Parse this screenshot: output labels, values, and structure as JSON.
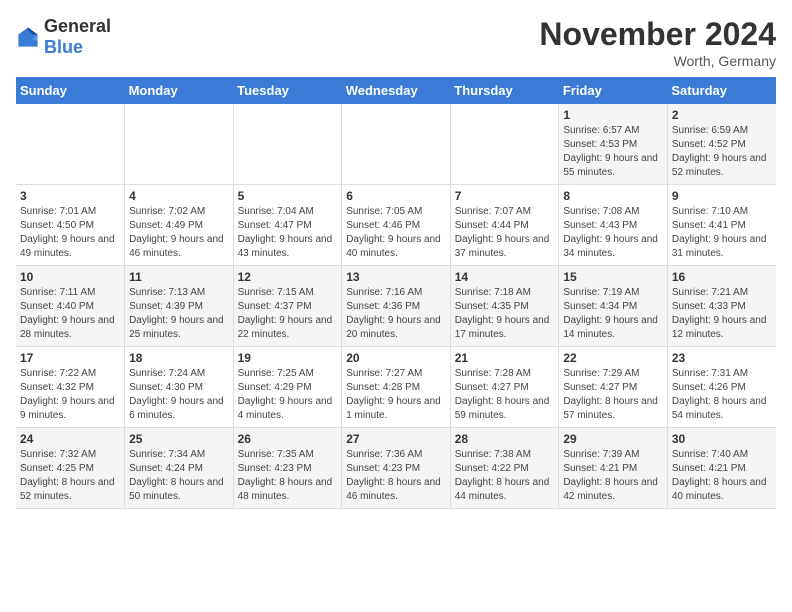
{
  "header": {
    "logo_general": "General",
    "logo_blue": "Blue",
    "title": "November 2024",
    "location": "Worth, Germany"
  },
  "days_of_week": [
    "Sunday",
    "Monday",
    "Tuesday",
    "Wednesday",
    "Thursday",
    "Friday",
    "Saturday"
  ],
  "weeks": [
    [
      {
        "day": "",
        "info": ""
      },
      {
        "day": "",
        "info": ""
      },
      {
        "day": "",
        "info": ""
      },
      {
        "day": "",
        "info": ""
      },
      {
        "day": "",
        "info": ""
      },
      {
        "day": "1",
        "info": "Sunrise: 6:57 AM\nSunset: 4:53 PM\nDaylight: 9 hours and 55 minutes."
      },
      {
        "day": "2",
        "info": "Sunrise: 6:59 AM\nSunset: 4:52 PM\nDaylight: 9 hours and 52 minutes."
      }
    ],
    [
      {
        "day": "3",
        "info": "Sunrise: 7:01 AM\nSunset: 4:50 PM\nDaylight: 9 hours and 49 minutes."
      },
      {
        "day": "4",
        "info": "Sunrise: 7:02 AM\nSunset: 4:49 PM\nDaylight: 9 hours and 46 minutes."
      },
      {
        "day": "5",
        "info": "Sunrise: 7:04 AM\nSunset: 4:47 PM\nDaylight: 9 hours and 43 minutes."
      },
      {
        "day": "6",
        "info": "Sunrise: 7:05 AM\nSunset: 4:46 PM\nDaylight: 9 hours and 40 minutes."
      },
      {
        "day": "7",
        "info": "Sunrise: 7:07 AM\nSunset: 4:44 PM\nDaylight: 9 hours and 37 minutes."
      },
      {
        "day": "8",
        "info": "Sunrise: 7:08 AM\nSunset: 4:43 PM\nDaylight: 9 hours and 34 minutes."
      },
      {
        "day": "9",
        "info": "Sunrise: 7:10 AM\nSunset: 4:41 PM\nDaylight: 9 hours and 31 minutes."
      }
    ],
    [
      {
        "day": "10",
        "info": "Sunrise: 7:11 AM\nSunset: 4:40 PM\nDaylight: 9 hours and 28 minutes."
      },
      {
        "day": "11",
        "info": "Sunrise: 7:13 AM\nSunset: 4:39 PM\nDaylight: 9 hours and 25 minutes."
      },
      {
        "day": "12",
        "info": "Sunrise: 7:15 AM\nSunset: 4:37 PM\nDaylight: 9 hours and 22 minutes."
      },
      {
        "day": "13",
        "info": "Sunrise: 7:16 AM\nSunset: 4:36 PM\nDaylight: 9 hours and 20 minutes."
      },
      {
        "day": "14",
        "info": "Sunrise: 7:18 AM\nSunset: 4:35 PM\nDaylight: 9 hours and 17 minutes."
      },
      {
        "day": "15",
        "info": "Sunrise: 7:19 AM\nSunset: 4:34 PM\nDaylight: 9 hours and 14 minutes."
      },
      {
        "day": "16",
        "info": "Sunrise: 7:21 AM\nSunset: 4:33 PM\nDaylight: 9 hours and 12 minutes."
      }
    ],
    [
      {
        "day": "17",
        "info": "Sunrise: 7:22 AM\nSunset: 4:32 PM\nDaylight: 9 hours and 9 minutes."
      },
      {
        "day": "18",
        "info": "Sunrise: 7:24 AM\nSunset: 4:30 PM\nDaylight: 9 hours and 6 minutes."
      },
      {
        "day": "19",
        "info": "Sunrise: 7:25 AM\nSunset: 4:29 PM\nDaylight: 9 hours and 4 minutes."
      },
      {
        "day": "20",
        "info": "Sunrise: 7:27 AM\nSunset: 4:28 PM\nDaylight: 9 hours and 1 minute."
      },
      {
        "day": "21",
        "info": "Sunrise: 7:28 AM\nSunset: 4:27 PM\nDaylight: 8 hours and 59 minutes."
      },
      {
        "day": "22",
        "info": "Sunrise: 7:29 AM\nSunset: 4:27 PM\nDaylight: 8 hours and 57 minutes."
      },
      {
        "day": "23",
        "info": "Sunrise: 7:31 AM\nSunset: 4:26 PM\nDaylight: 8 hours and 54 minutes."
      }
    ],
    [
      {
        "day": "24",
        "info": "Sunrise: 7:32 AM\nSunset: 4:25 PM\nDaylight: 8 hours and 52 minutes."
      },
      {
        "day": "25",
        "info": "Sunrise: 7:34 AM\nSunset: 4:24 PM\nDaylight: 8 hours and 50 minutes."
      },
      {
        "day": "26",
        "info": "Sunrise: 7:35 AM\nSunset: 4:23 PM\nDaylight: 8 hours and 48 minutes."
      },
      {
        "day": "27",
        "info": "Sunrise: 7:36 AM\nSunset: 4:23 PM\nDaylight: 8 hours and 46 minutes."
      },
      {
        "day": "28",
        "info": "Sunrise: 7:38 AM\nSunset: 4:22 PM\nDaylight: 8 hours and 44 minutes."
      },
      {
        "day": "29",
        "info": "Sunrise: 7:39 AM\nSunset: 4:21 PM\nDaylight: 8 hours and 42 minutes."
      },
      {
        "day": "30",
        "info": "Sunrise: 7:40 AM\nSunset: 4:21 PM\nDaylight: 8 hours and 40 minutes."
      }
    ]
  ]
}
